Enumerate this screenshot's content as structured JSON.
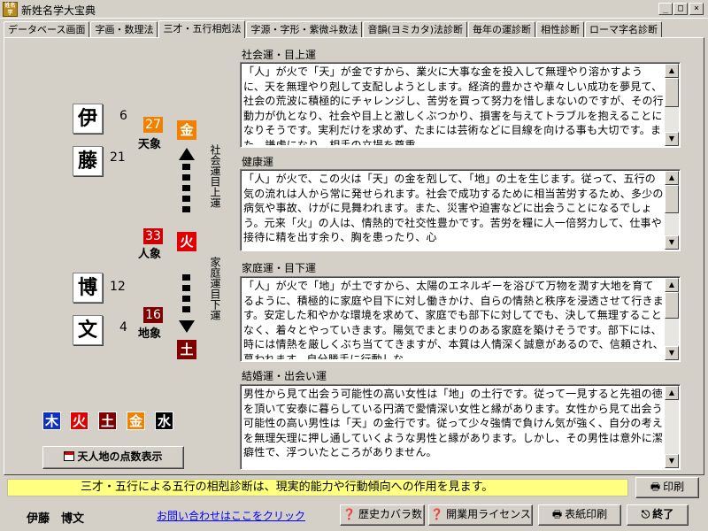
{
  "window": {
    "title": "新姓名学大宝典",
    "icon_text": "姓名学",
    "min": "_",
    "max": "□",
    "close": "×"
  },
  "tabs": [
    {
      "label": "データベース画面"
    },
    {
      "label": "字画・数理法"
    },
    {
      "label": "三才・五行相剋法"
    },
    {
      "label": "字源・字形・紫微斗数法"
    },
    {
      "label": "音韻(ヨミカタ)法診断"
    },
    {
      "label": "毎年の運診断"
    },
    {
      "label": "相性診断"
    },
    {
      "label": "ローマ字名診断"
    }
  ],
  "name": {
    "chars": [
      {
        "char": "伊",
        "strokes": "6"
      },
      {
        "char": "藤",
        "strokes": "21"
      },
      {
        "char": "博",
        "strokes": "12"
      },
      {
        "char": "文",
        "strokes": "4"
      }
    ],
    "full_name": "伊藤　博文"
  },
  "sancai": {
    "ten": {
      "number": "27",
      "label": "天象",
      "element": "金",
      "color": "#f08000",
      "element_color": "#f08000"
    },
    "jin": {
      "number": "33",
      "label": "人象",
      "element": "火",
      "color": "#d00000",
      "element_color": "#e00000"
    },
    "chi": {
      "number": "16",
      "label": "地象",
      "element": "土",
      "color": "#800000",
      "element_color": "#800000"
    },
    "upper_label": "社会運目上運",
    "lower_label": "家庭運目下運"
  },
  "legend": [
    {
      "element": "木",
      "color": "#1030c0"
    },
    {
      "element": "火",
      "color": "#e00000"
    },
    {
      "element": "土",
      "color": "#800000"
    },
    {
      "element": "金",
      "color": "#f08000"
    },
    {
      "element": "水",
      "color": "#000000"
    }
  ],
  "sections": [
    {
      "title": "社会運・目上運",
      "text": "「人」が火で「天」が金ですから、業火に大事な金を投入して無理やり溶かすように、天を無理やり剋して支配しようとします。経済的豊かさや華々しい成功を夢見て、社会の荒波に積極的にチャレンジし、苦労を買って努力を惜しまないのですが、その行動力が仇となり、社会や目上と激しくぶつかり、損害を与えてトラブルを抱えることになりそうです。実利だけを求めず、たまには芸術などに目線を向ける事も大切です。また、謙虚になり、相手の立場を尊重"
    },
    {
      "title": "健康運",
      "text": "「人」が火で、この火は「天」の金を剋して、「地」の土を生じます。従って、五行の気の流れは人から常に発せられます。社会で成功するために相当苦労するため、多少の病気や事故、けがに見舞われます。また、災害や迫害などに出会うことになるでしょう。元来「火」の人は、情熱的で社交性豊かです。苦労を糧に人一倍努力して、仕事や接待に精を出す余り、胸を患ったり、心"
    },
    {
      "title": "家庭運・目下運",
      "text": "「人」が火で「地」が土ですから、太陽のエネルギーを浴びて万物を潤す大地を育てるように、積極的に家庭や目下に対し働きかけ、自らの情熱と秩序を浸透させて行きます。安定した和やかな環境を求めて、家庭でも部下に対してでも、決して無理することなく、着々とやっていきます。陽気でまとまりのある家庭を築けそうです。部下には、時には情熱を厳しくぶち当ててきますが、本質は人情深く誠意があるので、信頼され、慕われます。自分勝手に行動しな"
    },
    {
      "title": "結婚運・出会い運",
      "text": "男性から見て出会う可能性の高い女性は「地」の土行です。従って一見すると先祖の徳を頂いて安泰に暮らしている円満で愛情深い女性と縁があります。女性から見て出会う可能性の高い男性は「天」の金行です。従って少々強情で負けん気が強く、自分の考えを無理矢理に押し通していくような男性と縁があります。しかし、その男性は意外に潔癖性で、浮ついたところがありません。"
    }
  ],
  "buttons": {
    "points": "天人地の点数表示",
    "print": "印刷",
    "history": "歴史カバラ数",
    "license": "開業用ライセンス",
    "cover_print": "表紙印刷",
    "exit": "終了"
  },
  "info_bar": "三才・五行による五行の相剋診断は、現実的能力や行動傾向への作用を見ます。",
  "contact_link": "お問い合わせはここをクリック"
}
